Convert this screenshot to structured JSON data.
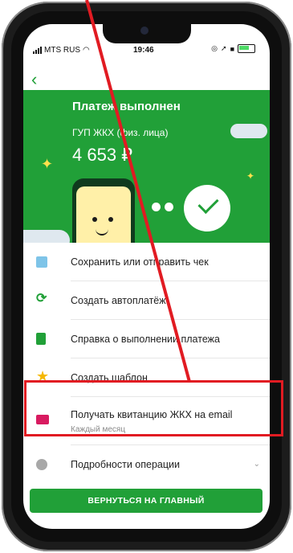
{
  "status_bar": {
    "carrier": "MTS RUS",
    "time": "19:46"
  },
  "header": {
    "back_label": "‹"
  },
  "hero": {
    "title": "Платеж выполнен",
    "organization": "ГУП ЖКХ (физ. лица)",
    "amount": "4 653 ₽"
  },
  "actions": [
    {
      "icon": "receipt-icon",
      "label": "Сохранить или отправить чек"
    },
    {
      "icon": "autopay-icon",
      "label": "Создать автоплатёж"
    },
    {
      "icon": "document-icon",
      "label": "Справка о выполнении платежа"
    },
    {
      "icon": "star-icon",
      "label": "Создать шаблон"
    },
    {
      "icon": "mail-icon",
      "label": "Получать квитанцию ЖКХ на email",
      "sublabel": "Каждый месяц"
    },
    {
      "icon": "info-icon",
      "label": "Подробности операции"
    }
  ],
  "main_button": "ВЕРНУТЬСЯ НА ГЛАВНЫЙ",
  "colors": {
    "accent": "#21a038",
    "annotation": "#e11b22"
  }
}
